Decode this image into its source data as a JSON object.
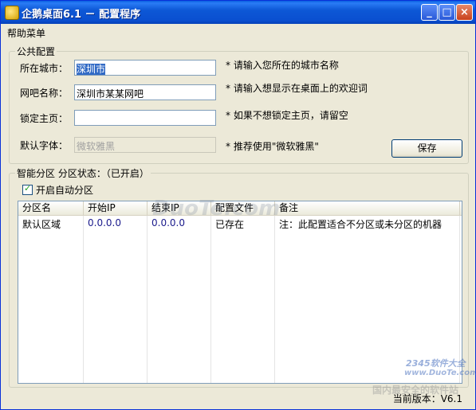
{
  "window": {
    "title": "企鹅桌面6.1 － 配置程序",
    "controls": {
      "minimize": "_",
      "maximize": "□",
      "close": "×"
    }
  },
  "menu": {
    "items": [
      "帮助菜单"
    ]
  },
  "public_config": {
    "legend": "公共配置",
    "city": {
      "label": "所在城市：",
      "value": "深圳市",
      "hint": "* 请输入您所在的城市名称"
    },
    "netbar": {
      "label": "网吧名称：",
      "value": "深圳市某某网吧",
      "hint": "* 请输入想显示在桌面上的欢迎词"
    },
    "homepage": {
      "label": "锁定主页：",
      "value": "",
      "hint": "* 如果不想锁定主页，请留空"
    },
    "font": {
      "label": "默认字体：",
      "value": "微软雅黑",
      "hint": "* 推荐使用\"微软雅黑\""
    },
    "save_button": "保存"
  },
  "smart_partition": {
    "legend": "智能分区  分区状态：（已开启）",
    "auto_checkbox": {
      "label": "开启自动分区",
      "checked": true
    },
    "columns": [
      "分区名",
      "开始IP",
      "结束IP",
      "配置文件",
      "备注"
    ],
    "rows": [
      [
        "默认区域",
        "0.0.0.0",
        "0.0.0.0",
        "已存在",
        "注：此配置适合不分区或未分区的机器"
      ]
    ]
  },
  "status": {
    "version_text": "当前版本：V6.1"
  },
  "watermarks": {
    "center": "DuoTe.com",
    "brand": "2345软件大全",
    "site": "www.DuoTe.com",
    "slogan": "国内最安全的软件站"
  }
}
